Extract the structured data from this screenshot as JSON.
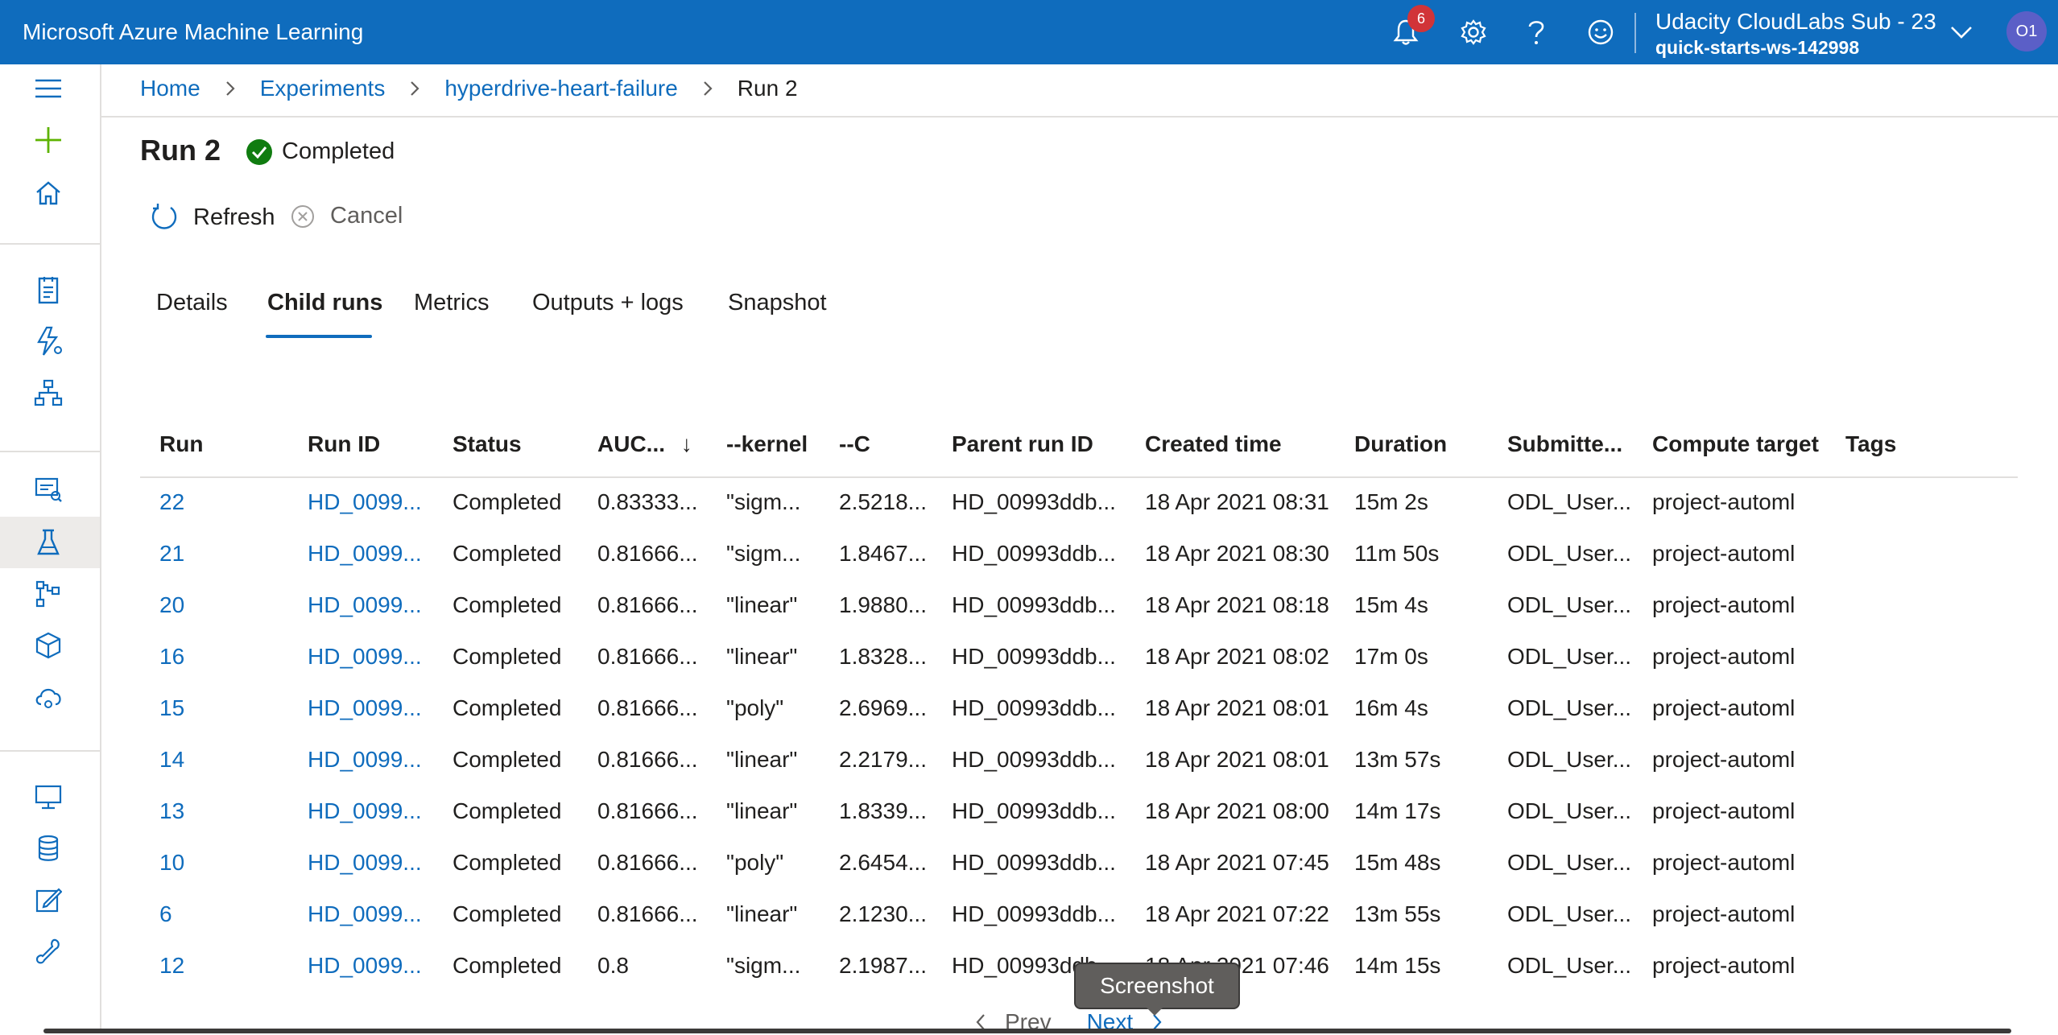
{
  "topbar": {
    "app_title": "Microsoft Azure Machine Learning",
    "notifications_count": "6",
    "account_name": "Udacity CloudLabs Sub - 23",
    "workspace": "quick-starts-ws-142998",
    "avatar_initials": "O1"
  },
  "breadcrumb": {
    "items": [
      "Home",
      "Experiments",
      "hyperdrive-heart-failure",
      "Run 2"
    ]
  },
  "run": {
    "title": "Run 2",
    "status": "Completed"
  },
  "commands": {
    "refresh": "Refresh",
    "cancel": "Cancel"
  },
  "tabs": [
    "Details",
    "Child runs",
    "Metrics",
    "Outputs + logs",
    "Snapshot"
  ],
  "selected_tab": "Child runs",
  "table": {
    "columns": [
      "Run",
      "Run ID",
      "Status",
      "AUC...",
      "--kernel",
      "--C",
      "Parent run ID",
      "Created time",
      "Duration",
      "Submitte...",
      "Compute target",
      "Tags"
    ],
    "sort_indicator": "↓",
    "rows": [
      [
        "22",
        "HD_0099...",
        "Completed",
        "0.83333...",
        "\"sigm...",
        "2.5218...",
        "HD_00993ddb...",
        "18 Apr 2021 08:31",
        "15m 2s",
        "ODL_User...",
        "project-automl",
        ""
      ],
      [
        "21",
        "HD_0099...",
        "Completed",
        "0.81666...",
        "\"sigm...",
        "1.8467...",
        "HD_00993ddb...",
        "18 Apr 2021 08:30",
        "11m 50s",
        "ODL_User...",
        "project-automl",
        ""
      ],
      [
        "20",
        "HD_0099...",
        "Completed",
        "0.81666...",
        "\"linear\"",
        "1.9880...",
        "HD_00993ddb...",
        "18 Apr 2021 08:18",
        "15m 4s",
        "ODL_User...",
        "project-automl",
        ""
      ],
      [
        "16",
        "HD_0099...",
        "Completed",
        "0.81666...",
        "\"linear\"",
        "1.8328...",
        "HD_00993ddb...",
        "18 Apr 2021 08:02",
        "17m 0s",
        "ODL_User...",
        "project-automl",
        ""
      ],
      [
        "15",
        "HD_0099...",
        "Completed",
        "0.81666...",
        "\"poly\"",
        "2.6969...",
        "HD_00993ddb...",
        "18 Apr 2021 08:01",
        "16m 4s",
        "ODL_User...",
        "project-automl",
        ""
      ],
      [
        "14",
        "HD_0099...",
        "Completed",
        "0.81666...",
        "\"linear\"",
        "2.2179...",
        "HD_00993ddb...",
        "18 Apr 2021 08:01",
        "13m 57s",
        "ODL_User...",
        "project-automl",
        ""
      ],
      [
        "13",
        "HD_0099...",
        "Completed",
        "0.81666...",
        "\"linear\"",
        "1.8339...",
        "HD_00993ddb...",
        "18 Apr 2021 08:00",
        "14m 17s",
        "ODL_User...",
        "project-automl",
        ""
      ],
      [
        "10",
        "HD_0099...",
        "Completed",
        "0.81666...",
        "\"poly\"",
        "2.6454...",
        "HD_00993ddb...",
        "18 Apr 2021 07:45",
        "15m 48s",
        "ODL_User...",
        "project-automl",
        ""
      ],
      [
        "6",
        "HD_0099...",
        "Completed",
        "0.81666...",
        "\"linear\"",
        "2.1230...",
        "HD_00993ddb...",
        "18 Apr 2021 07:22",
        "13m 55s",
        "ODL_User...",
        "project-automl",
        ""
      ],
      [
        "12",
        "HD_0099...",
        "Completed",
        "0.8",
        "\"sigm...",
        "2.1987...",
        "HD_00993ddb...",
        "18 Apr 2021 07:46",
        "14m 15s",
        "ODL_User...",
        "project-automl",
        ""
      ]
    ]
  },
  "pager": {
    "prev": "Prev",
    "next": "Next"
  },
  "tooltip": "Screenshot",
  "colors": {
    "brand": "#0f6cbd",
    "success": "#107c10",
    "badge": "#d13438"
  },
  "sidebar_icons": [
    "hamburger-icon",
    "plus-icon",
    "home-icon",
    "notebook-icon",
    "automl-icon",
    "designer-icon",
    "datasets-icon",
    "experiments-icon",
    "pipelines-icon",
    "models-icon",
    "endpoints-icon",
    "compute-icon",
    "datastores-icon",
    "labeling-icon",
    "linked-services-icon"
  ]
}
